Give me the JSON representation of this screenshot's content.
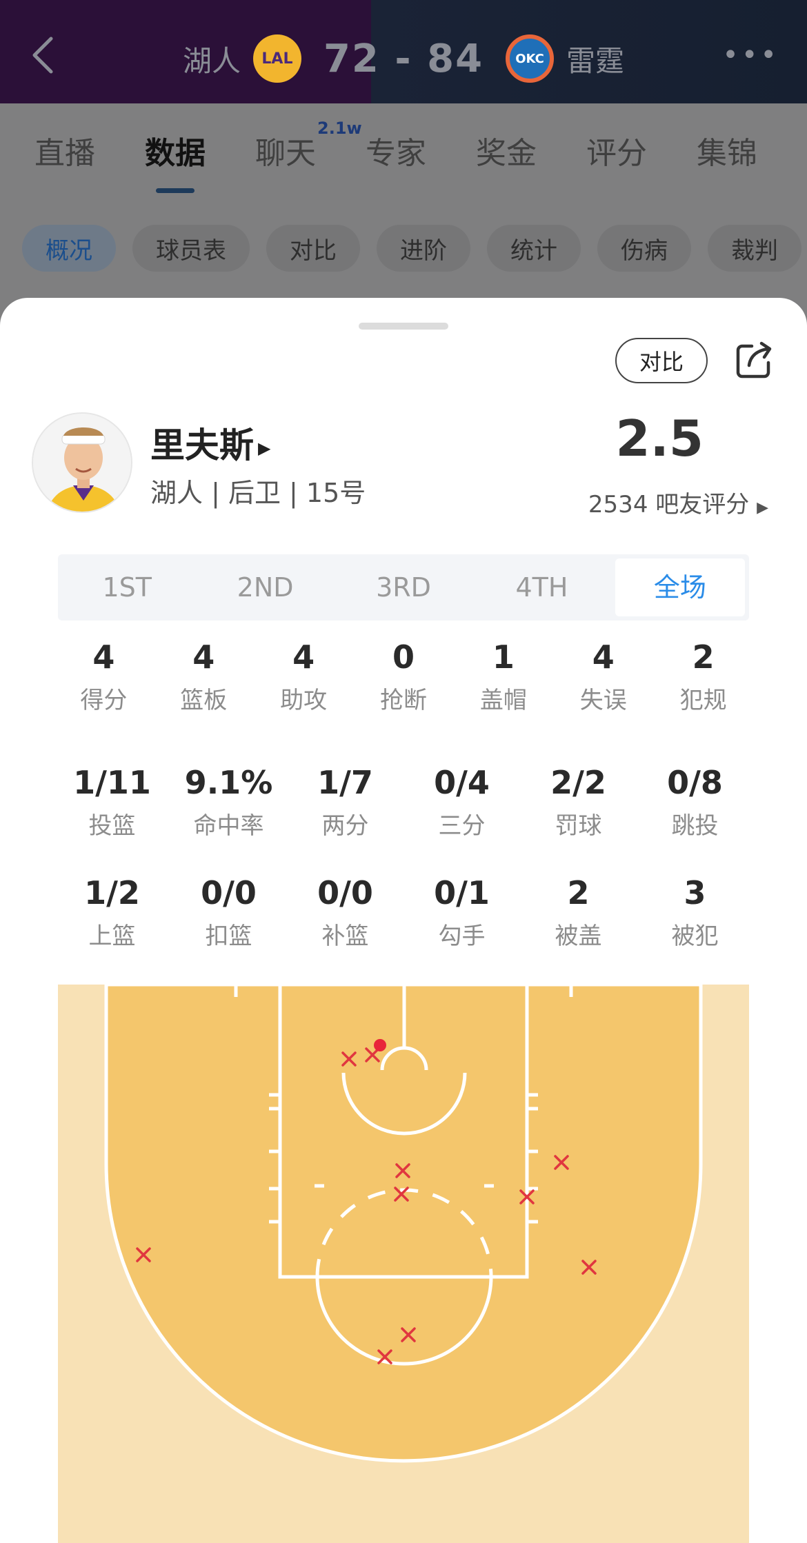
{
  "header": {
    "home_team": "湖人",
    "home_logo": "LAL",
    "score": "72 - 84",
    "away_logo": "OKC",
    "away_team": "雷霆"
  },
  "tabs": [
    {
      "label": "直播"
    },
    {
      "label": "数据"
    },
    {
      "label": "聊天",
      "badge": "2.1w"
    },
    {
      "label": "专家"
    },
    {
      "label": "奖金"
    },
    {
      "label": "评分"
    },
    {
      "label": "集锦"
    }
  ],
  "chips": [
    "概况",
    "球员表",
    "对比",
    "进阶",
    "统计",
    "伤病",
    "裁判"
  ],
  "sheet": {
    "compare_label": "对比",
    "player": {
      "name": "里夫斯",
      "meta": "湖人 | 后卫 | 15号",
      "rating": "2.5",
      "rating_sub": "2534 吧友评分"
    },
    "periods": [
      "1ST",
      "2ND",
      "3RD",
      "4TH",
      "全场"
    ],
    "active_period": "全场",
    "row1": [
      {
        "v": "4",
        "l": "得分"
      },
      {
        "v": "4",
        "l": "篮板"
      },
      {
        "v": "4",
        "l": "助攻"
      },
      {
        "v": "0",
        "l": "抢断"
      },
      {
        "v": "1",
        "l": "盖帽"
      },
      {
        "v": "4",
        "l": "失误"
      },
      {
        "v": "2",
        "l": "犯规"
      }
    ],
    "row2": [
      {
        "v": "1/11",
        "l": "投篮"
      },
      {
        "v": "9.1%",
        "l": "命中率"
      },
      {
        "v": "1/7",
        "l": "两分"
      },
      {
        "v": "0/4",
        "l": "三分"
      },
      {
        "v": "2/2",
        "l": "罚球"
      },
      {
        "v": "0/8",
        "l": "跳投"
      }
    ],
    "row3": [
      {
        "v": "1/2",
        "l": "上篮"
      },
      {
        "v": "0/0",
        "l": "扣篮"
      },
      {
        "v": "0/0",
        "l": "补篮"
      },
      {
        "v": "0/1",
        "l": "勾手"
      },
      {
        "v": "2",
        "l": "被盖"
      },
      {
        "v": "3",
        "l": "被犯"
      }
    ]
  },
  "colors": {
    "court_outer": "#f8e1b5",
    "court_inner": "#f4c66c",
    "miss": "#e0363f",
    "make": "#e8243a",
    "accent": "#2a8ce8"
  }
}
